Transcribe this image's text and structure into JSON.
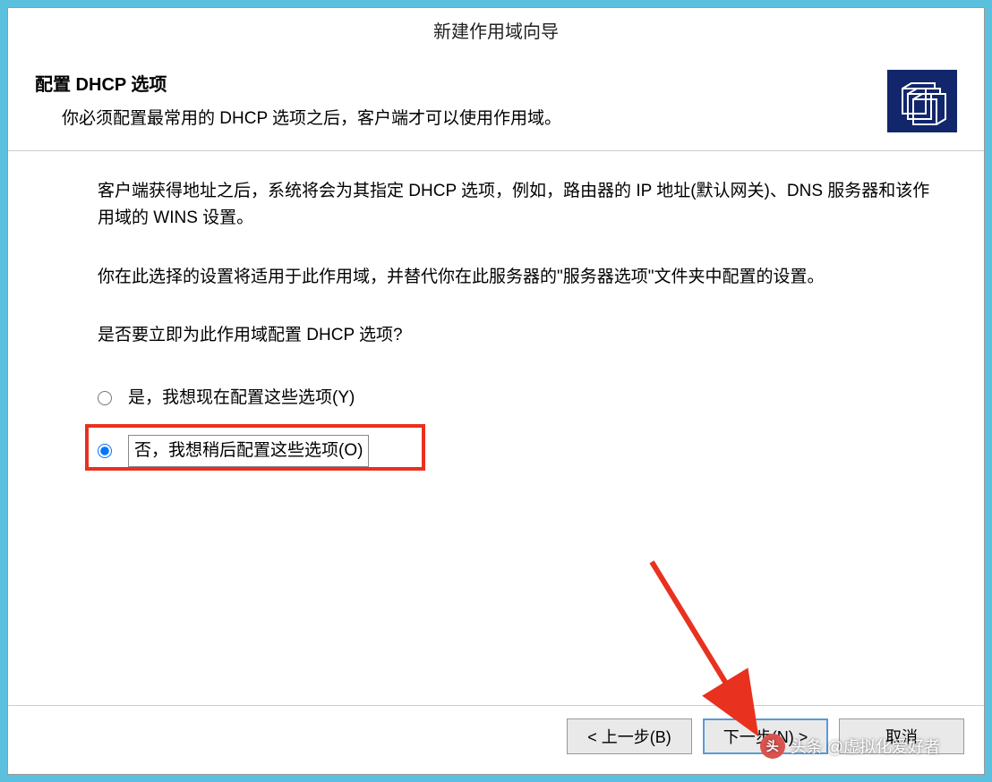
{
  "window": {
    "title": "新建作用域向导"
  },
  "header": {
    "title": "配置 DHCP 选项",
    "subtitle": "你必须配置最常用的 DHCP 选项之后，客户端才可以使用作用域。",
    "icon_name": "folders-icon"
  },
  "content": {
    "para1": "客户端获得地址之后，系统将会为其指定 DHCP 选项，例如，路由器的 IP 地址(默认网关)、DNS 服务器和该作用域的 WINS 设置。",
    "para2": "你在此选择的设置将适用于此作用域，并替代你在此服务器的\"服务器选项\"文件夹中配置的设置。",
    "question": "是否要立即为此作用域配置 DHCP 选项?",
    "options": {
      "yes_label": "是，我想现在配置这些选项(Y)",
      "no_label": "否，我想稍后配置这些选项(O)",
      "selected": "no"
    }
  },
  "buttons": {
    "back": "< 上一步(B)",
    "next": "下一步(N) >",
    "cancel": "取消"
  },
  "watermark": {
    "text": "头条 @虚拟化爱好者"
  }
}
